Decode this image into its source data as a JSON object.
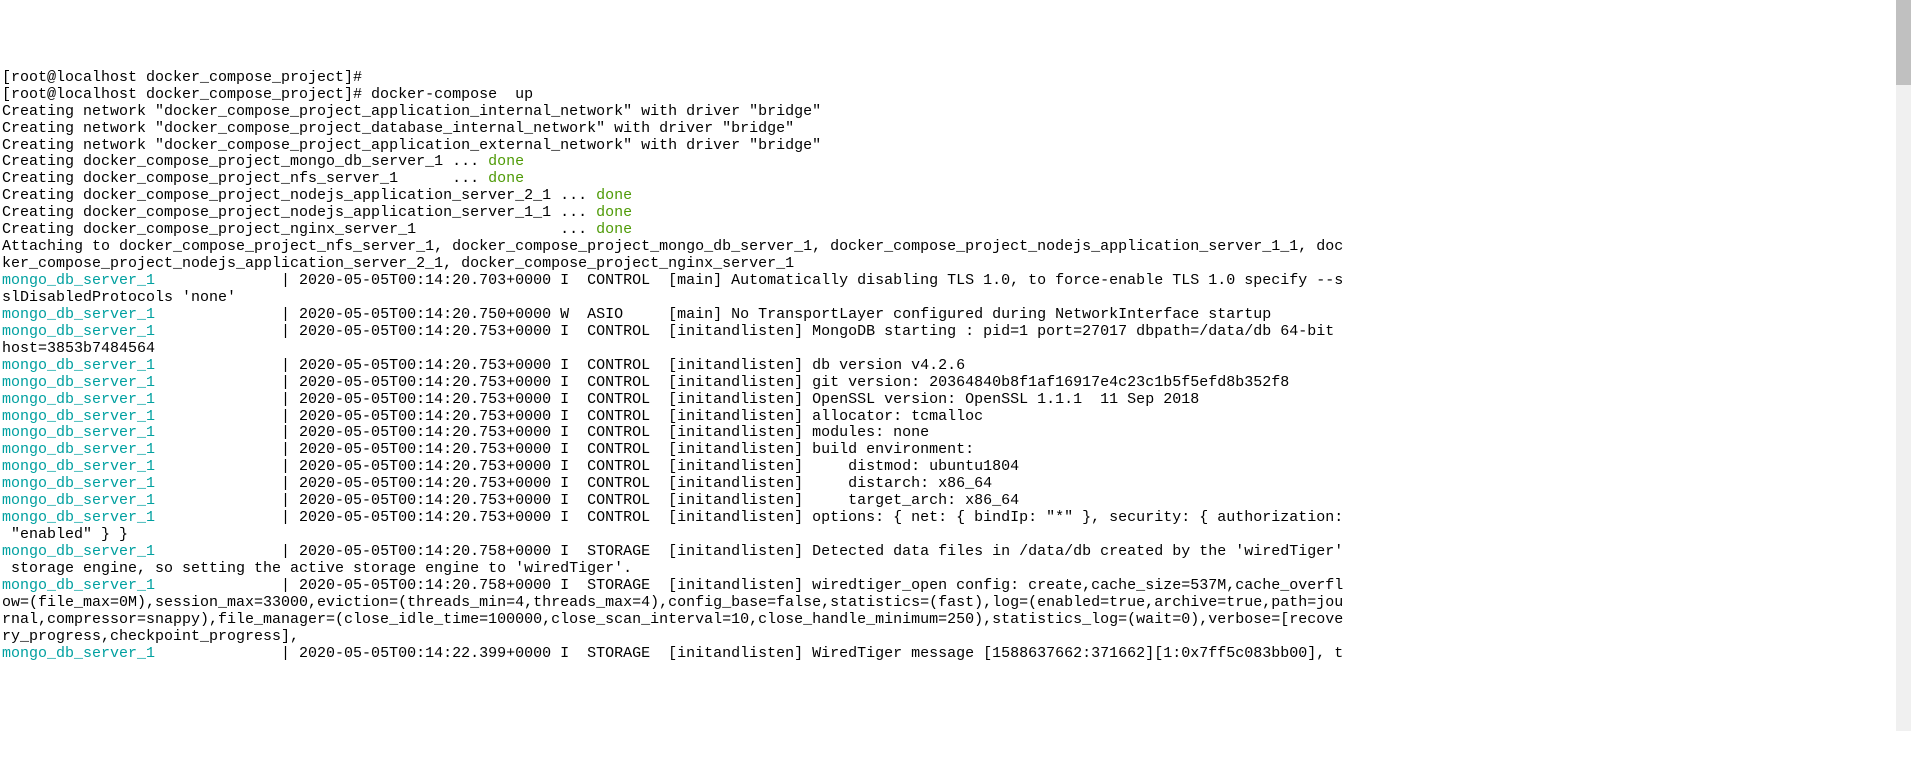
{
  "lines": [
    {
      "segments": [
        {
          "text": "[root@localhost docker_compose_project]#"
        }
      ]
    },
    {
      "segments": [
        {
          "text": "[root@localhost docker_compose_project]# docker-compose  up"
        }
      ]
    },
    {
      "segments": [
        {
          "text": "Creating network \"docker_compose_project_application_internal_network\" with driver \"bridge\""
        }
      ]
    },
    {
      "segments": [
        {
          "text": "Creating network \"docker_compose_project_database_internal_network\" with driver \"bridge\""
        }
      ]
    },
    {
      "segments": [
        {
          "text": "Creating network \"docker_compose_project_application_external_network\" with driver \"bridge\""
        }
      ]
    },
    {
      "segments": [
        {
          "text": "Creating docker_compose_project_mongo_db_server_1 ... "
        },
        {
          "text": "done",
          "cls": "done"
        }
      ]
    },
    {
      "segments": [
        {
          "text": "Creating docker_compose_project_nfs_server_1      ... "
        },
        {
          "text": "done",
          "cls": "done"
        }
      ]
    },
    {
      "segments": [
        {
          "text": "Creating docker_compose_project_nodejs_application_server_2_1 ... "
        },
        {
          "text": "done",
          "cls": "done"
        }
      ]
    },
    {
      "segments": [
        {
          "text": "Creating docker_compose_project_nodejs_application_server_1_1 ... "
        },
        {
          "text": "done",
          "cls": "done"
        }
      ]
    },
    {
      "segments": [
        {
          "text": "Creating docker_compose_project_nginx_server_1                ... "
        },
        {
          "text": "done",
          "cls": "done"
        }
      ]
    },
    {
      "segments": [
        {
          "text": "Attaching to docker_compose_project_nfs_server_1, docker_compose_project_mongo_db_server_1, docker_compose_project_nodejs_application_server_1_1, doc"
        }
      ]
    },
    {
      "segments": [
        {
          "text": "ker_compose_project_nodejs_application_server_2_1, docker_compose_project_nginx_server_1"
        }
      ]
    },
    {
      "segments": [
        {
          "text": "mongo_db_server_1              ",
          "cls": "service-name"
        },
        {
          "text": "| 2020-05-05T00:14:20.703+0000 I  CONTROL  [main] Automatically disabling TLS 1.0, to force-enable TLS 1.0 specify --s"
        }
      ]
    },
    {
      "segments": [
        {
          "text": "slDisabledProtocols 'none'"
        }
      ]
    },
    {
      "segments": [
        {
          "text": "mongo_db_server_1              ",
          "cls": "service-name"
        },
        {
          "text": "| 2020-05-05T00:14:20.750+0000 W  ASIO     [main] No TransportLayer configured during NetworkInterface startup"
        }
      ]
    },
    {
      "segments": [
        {
          "text": "mongo_db_server_1              ",
          "cls": "service-name"
        },
        {
          "text": "| 2020-05-05T00:14:20.753+0000 I  CONTROL  [initandlisten] MongoDB starting : pid=1 port=27017 dbpath=/data/db 64-bit "
        }
      ]
    },
    {
      "segments": [
        {
          "text": "host=3853b7484564"
        }
      ]
    },
    {
      "segments": [
        {
          "text": "mongo_db_server_1              ",
          "cls": "service-name"
        },
        {
          "text": "| 2020-05-05T00:14:20.753+0000 I  CONTROL  [initandlisten] db version v4.2.6"
        }
      ]
    },
    {
      "segments": [
        {
          "text": "mongo_db_server_1              ",
          "cls": "service-name"
        },
        {
          "text": "| 2020-05-05T00:14:20.753+0000 I  CONTROL  [initandlisten] git version: 20364840b8f1af16917e4c23c1b5f5efd8b352f8"
        }
      ]
    },
    {
      "segments": [
        {
          "text": "mongo_db_server_1              ",
          "cls": "service-name"
        },
        {
          "text": "| 2020-05-05T00:14:20.753+0000 I  CONTROL  [initandlisten] OpenSSL version: OpenSSL 1.1.1  11 Sep 2018"
        }
      ]
    },
    {
      "segments": [
        {
          "text": "mongo_db_server_1              ",
          "cls": "service-name"
        },
        {
          "text": "| 2020-05-05T00:14:20.753+0000 I  CONTROL  [initandlisten] allocator: tcmalloc"
        }
      ]
    },
    {
      "segments": [
        {
          "text": "mongo_db_server_1              ",
          "cls": "service-name"
        },
        {
          "text": "| 2020-05-05T00:14:20.753+0000 I  CONTROL  [initandlisten] modules: none"
        }
      ]
    },
    {
      "segments": [
        {
          "text": "mongo_db_server_1              ",
          "cls": "service-name"
        },
        {
          "text": "| 2020-05-05T00:14:20.753+0000 I  CONTROL  [initandlisten] build environment:"
        }
      ]
    },
    {
      "segments": [
        {
          "text": "mongo_db_server_1              ",
          "cls": "service-name"
        },
        {
          "text": "| 2020-05-05T00:14:20.753+0000 I  CONTROL  [initandlisten]     distmod: ubuntu1804"
        }
      ]
    },
    {
      "segments": [
        {
          "text": "mongo_db_server_1              ",
          "cls": "service-name"
        },
        {
          "text": "| 2020-05-05T00:14:20.753+0000 I  CONTROL  [initandlisten]     distarch: x86_64"
        }
      ]
    },
    {
      "segments": [
        {
          "text": "mongo_db_server_1              ",
          "cls": "service-name"
        },
        {
          "text": "| 2020-05-05T00:14:20.753+0000 I  CONTROL  [initandlisten]     target_arch: x86_64"
        }
      ]
    },
    {
      "segments": [
        {
          "text": "mongo_db_server_1              ",
          "cls": "service-name"
        },
        {
          "text": "| 2020-05-05T00:14:20.753+0000 I  CONTROL  [initandlisten] options: { net: { bindIp: \"*\" }, security: { authorization:"
        }
      ]
    },
    {
      "segments": [
        {
          "text": " \"enabled\" } }"
        }
      ]
    },
    {
      "segments": [
        {
          "text": "mongo_db_server_1              ",
          "cls": "service-name"
        },
        {
          "text": "| 2020-05-05T00:14:20.758+0000 I  STORAGE  [initandlisten] Detected data files in /data/db created by the 'wiredTiger'"
        }
      ]
    },
    {
      "segments": [
        {
          "text": " storage engine, so setting the active storage engine to 'wiredTiger'."
        }
      ]
    },
    {
      "segments": [
        {
          "text": "mongo_db_server_1              ",
          "cls": "service-name"
        },
        {
          "text": "| 2020-05-05T00:14:20.758+0000 I  STORAGE  [initandlisten] wiredtiger_open config: create,cache_size=537M,cache_overfl"
        }
      ]
    },
    {
      "segments": [
        {
          "text": "ow=(file_max=0M),session_max=33000,eviction=(threads_min=4,threads_max=4),config_base=false,statistics=(fast),log=(enabled=true,archive=true,path=jou"
        }
      ]
    },
    {
      "segments": [
        {
          "text": "rnal,compressor=snappy),file_manager=(close_idle_time=100000,close_scan_interval=10,close_handle_minimum=250),statistics_log=(wait=0),verbose=[recove"
        }
      ]
    },
    {
      "segments": [
        {
          "text": "ry_progress,checkpoint_progress],"
        }
      ]
    },
    {
      "segments": [
        {
          "text": "mongo_db_server_1              ",
          "cls": "service-name"
        },
        {
          "text": "| 2020-05-05T00:14:22.399+0000 I  STORAGE  [initandlisten] WiredTiger message [1588637662:371662][1:0x7ff5c083bb00], t"
        }
      ]
    }
  ]
}
